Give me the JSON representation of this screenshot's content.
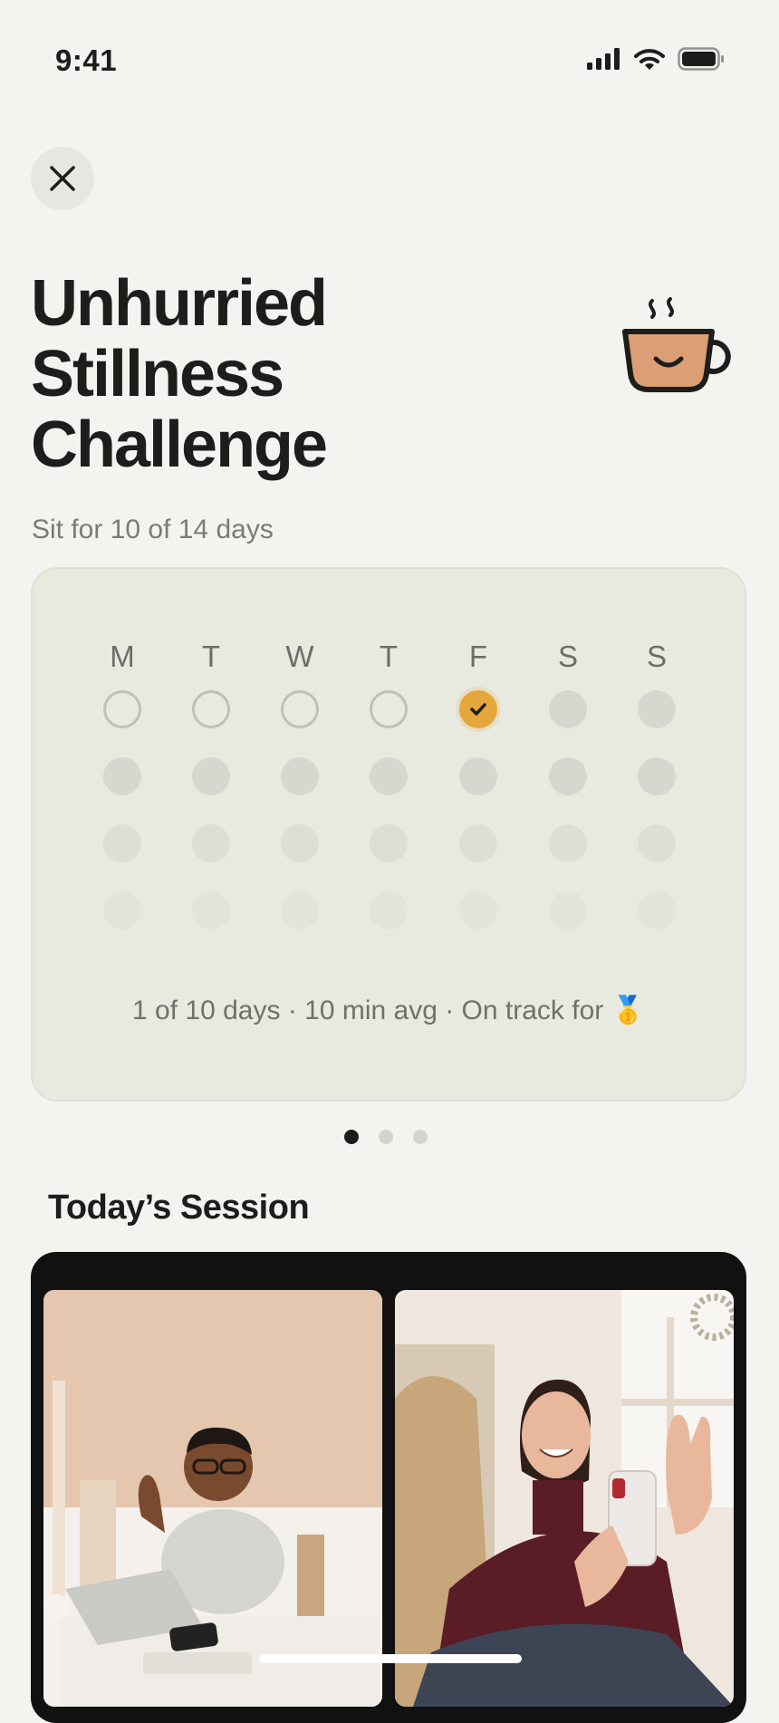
{
  "status": {
    "time": "9:41"
  },
  "challenge": {
    "title_lines": [
      "Unhurried",
      "Stillness",
      "Challenge"
    ],
    "subtitle": "Sit for 10 of 14 days"
  },
  "calendar": {
    "day_labels": [
      "M",
      "T",
      "W",
      "T",
      "F",
      "S",
      "S"
    ],
    "week1_states": [
      "empty",
      "empty",
      "empty",
      "empty",
      "done",
      "future",
      "future"
    ],
    "completed_days": 1,
    "footer": "1 of 10 days · 10 min avg · On track for 🥇"
  },
  "pager": {
    "pages": 3,
    "active_index": 0
  },
  "session": {
    "section_title": "Today’s Session"
  },
  "colors": {
    "accent": "#e5a73c",
    "background": "#f3f4ef",
    "card": "#e8eae0",
    "cup": "#dc9e74"
  },
  "icons": [
    "signal-icon",
    "wifi-icon",
    "battery-icon",
    "close-icon",
    "coffee-cup-icon",
    "check-icon",
    "medal-icon"
  ]
}
